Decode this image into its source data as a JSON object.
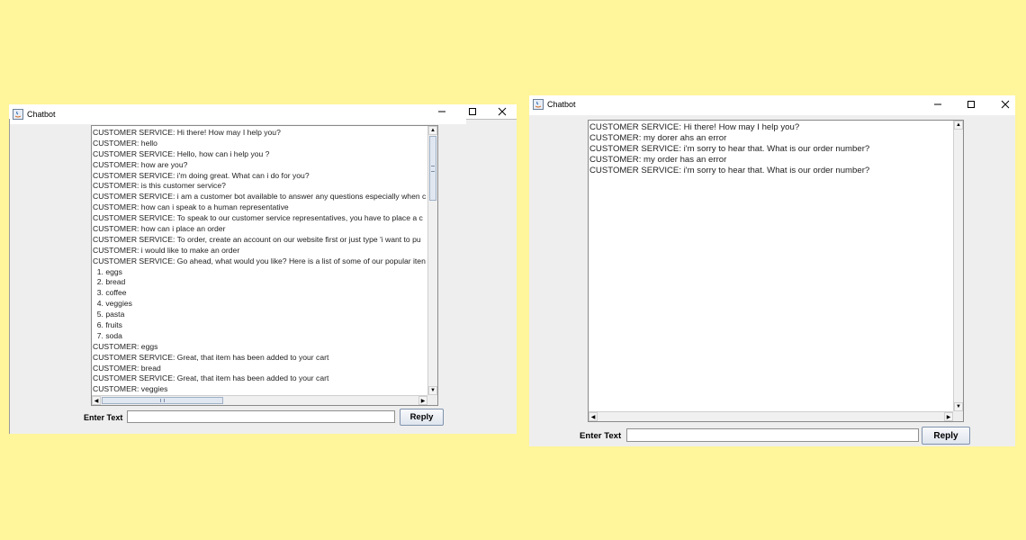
{
  "window1": {
    "title": "Chatbot",
    "messages": [
      "CUSTOMER SERVICE: Hi there! How may I help you?",
      "CUSTOMER: hello",
      "CUSTOMER SERVICE: Hello, how can i help you ?",
      "CUSTOMER: how are you?",
      "CUSTOMER SERVICE: i'm doing great. What can i do for you?",
      "CUSTOMER: is this customer service?",
      "CUSTOMER SERVICE: i am a customer bot available to answer any questions especially when c",
      "CUSTOMER: how can i speak to a human representative",
      "CUSTOMER SERVICE: To speak to our customer service representatives, you have to place a c",
      "CUSTOMER: how can i place an order",
      "CUSTOMER SERVICE: To order, create an account on our website first or just type 'i want to pu",
      "CUSTOMER: i would like to make an order",
      "CUSTOMER SERVICE: Go ahead, what would you like? Here is a list of some of our popular iten",
      "  1. eggs",
      "  2. bread",
      "  3. coffee",
      "  4. veggies",
      "  5. pasta",
      "  6. fruits",
      "  7. soda",
      "CUSTOMER: eggs",
      "CUSTOMER SERVICE: Great, that item has been added to your cart",
      "CUSTOMER: bread",
      "CUSTOMER SERVICE: Great, that item has been added to your cart",
      "CUSTOMER: veggies"
    ],
    "enter_label": "Enter Text",
    "input_value": "",
    "reply_label": "Reply"
  },
  "window2": {
    "title": "Chatbot",
    "messages": [
      "CUSTOMER SERVICE: Hi there! How may I help you?",
      "CUSTOMER: my dorer ahs an error",
      "CUSTOMER SERVICE: i'm sorry to hear that. What is our order number?",
      "CUSTOMER: my order has an error",
      "CUSTOMER SERVICE: i'm sorry to hear that. What is our order number?"
    ],
    "enter_label": "Enter Text",
    "input_value": "",
    "reply_label": "Reply"
  },
  "colors": {
    "background": "#fff59a",
    "window": "#eeeeee",
    "button_border": "#7f93ad"
  },
  "icons": [
    "java-app-icon",
    "minimize-icon",
    "maximize-icon",
    "close-icon"
  ]
}
